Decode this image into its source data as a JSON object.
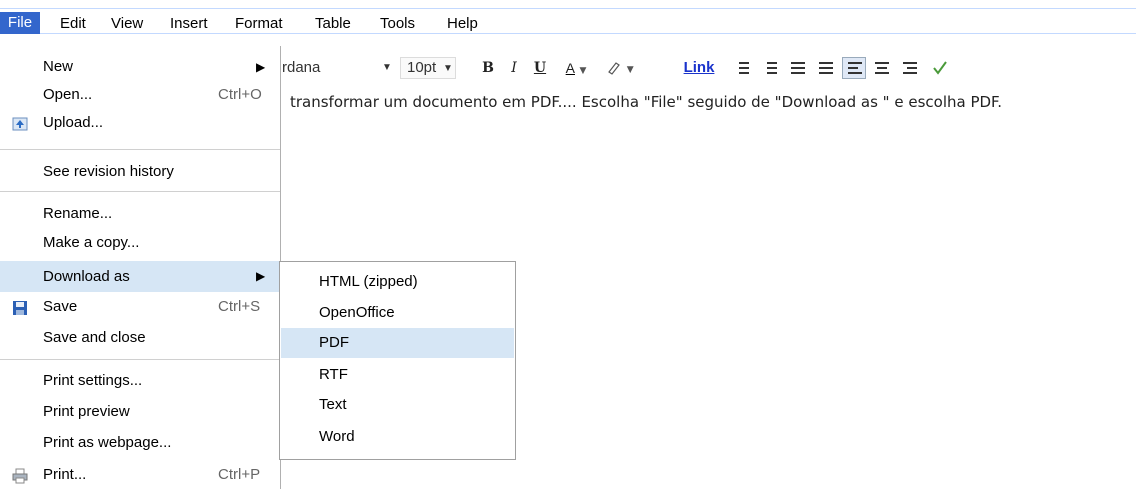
{
  "menubar": {
    "items": [
      "File",
      "Edit",
      "View",
      "Insert",
      "Format",
      "Table",
      "Tools",
      "Help"
    ]
  },
  "toolbar": {
    "font_name": "rdana",
    "font_size": "10pt",
    "bold": "B",
    "italic": "I",
    "underline": "U",
    "text_color": "A",
    "link": "Link"
  },
  "document": {
    "text": "transformar um documento em PDF.... Escolha \"File\" seguido de \"Download as \" e escolha PDF."
  },
  "file_menu": {
    "items": [
      {
        "label": "New",
        "shortcut": "",
        "submenu": true,
        "icon": ""
      },
      {
        "label": "Open...",
        "shortcut": "Ctrl+O",
        "submenu": false,
        "icon": ""
      },
      {
        "label": "Upload...",
        "shortcut": "",
        "submenu": false,
        "icon": "upload-icon"
      },
      {
        "label": "See revision history",
        "shortcut": "",
        "submenu": false,
        "icon": ""
      },
      {
        "label": "Rename...",
        "shortcut": "",
        "submenu": false,
        "icon": ""
      },
      {
        "label": "Make a copy...",
        "shortcut": "",
        "submenu": false,
        "icon": ""
      },
      {
        "label": "Download as",
        "shortcut": "",
        "submenu": true,
        "icon": "",
        "highlighted": true
      },
      {
        "label": "Save",
        "shortcut": "Ctrl+S",
        "submenu": false,
        "icon": "floppy-icon"
      },
      {
        "label": "Save and close",
        "shortcut": "",
        "submenu": false,
        "icon": ""
      },
      {
        "label": "Print settings...",
        "shortcut": "",
        "submenu": false,
        "icon": ""
      },
      {
        "label": "Print preview",
        "shortcut": "",
        "submenu": false,
        "icon": ""
      },
      {
        "label": "Print as webpage...",
        "shortcut": "",
        "submenu": false,
        "icon": ""
      },
      {
        "label": "Print...",
        "shortcut": "Ctrl+P",
        "submenu": false,
        "icon": "printer-icon"
      }
    ]
  },
  "download_submenu": {
    "items": [
      {
        "label": "HTML (zipped)"
      },
      {
        "label": "OpenOffice"
      },
      {
        "label": "PDF",
        "highlighted": true
      },
      {
        "label": "RTF"
      },
      {
        "label": "Text"
      },
      {
        "label": "Word"
      }
    ]
  },
  "colors": {
    "menu_active_bg": "#3366cc",
    "item_highlight": "#d6e6f5",
    "link": "#1a33cc"
  }
}
